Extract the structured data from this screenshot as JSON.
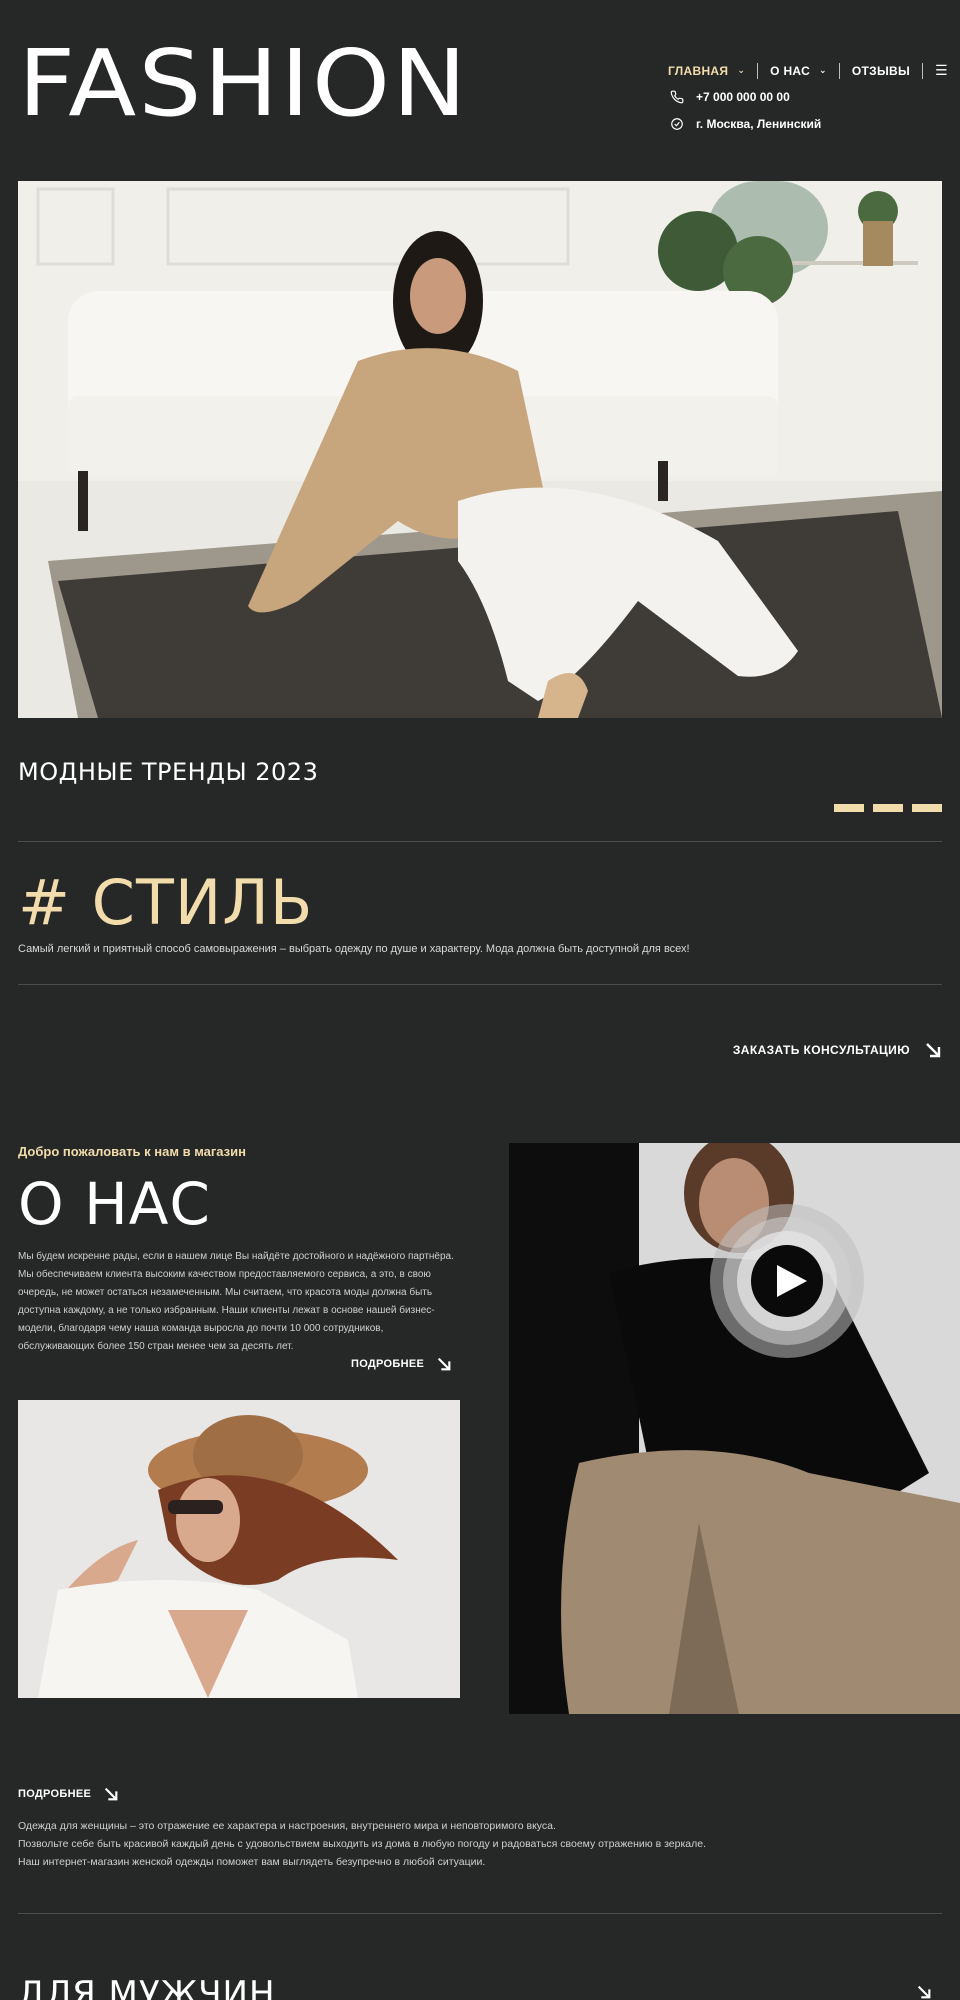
{
  "header": {
    "logo": "FASHION",
    "nav": [
      {
        "label": "ГЛАВНАЯ",
        "active": true,
        "has_dropdown": true
      },
      {
        "label": "О НАС",
        "active": false,
        "has_dropdown": true
      },
      {
        "label": "ОТЗЫВЫ",
        "active": false,
        "has_dropdown": false
      }
    ],
    "menu_icon": "hamburger-icon",
    "phone": "+7 000 000 00 00",
    "address": "г. Москва, Ленинский"
  },
  "hero": {
    "image": "woman-in-beige-sweater-sitting-on-rug-photo"
  },
  "trends": {
    "title": "МОДНЫЕ ТРЕНДЫ 2023",
    "slider_count": 3
  },
  "style": {
    "title": "# СТИЛЬ",
    "description": "Самый легкий и приятный способ самовыражения – выбрать одежду по душе и характеру. Мода должна быть доступной для всех!"
  },
  "consultation": {
    "label": "ЗАКАЗАТЬ КОНСУЛЬТАЦИЮ"
  },
  "about": {
    "welcome": "Добро пожаловать к нам в магазин",
    "title": "О НАС",
    "text": "Мы будем искренне рады, если в нашем лице Вы найдёте достойного и надёжного партнёра. Мы обеспечиваем клиента высоким качеством предоставляемого сервиса, а это, в свою очередь, не может остаться незамеченным. Мы считаем, что красота моды должна быть доступна каждому, а не только избранным. Наши клиенты лежат в основе нашей бизнес-модели, благодаря чему наша команда выросла до почти 10 000 сотрудников, обслуживающих более 150 стран менее чем за десять лет.",
    "more_label": "ПОДРОБНЕЕ"
  },
  "women": {
    "more_label": "ПОДРОБНЕЕ",
    "lines": [
      "Одежда для женщины – это отражение ее характера и настроения, внутреннего мира и неповторимого вкуса.",
      "Позвольте себе быть красивой каждый день с удовольствием выходить из дома в любую погоду и радоваться своему отражению в зеркале.",
      "Наш интернет-магазин женской одежды поможет вам выглядеть безупречно в любой ситуации."
    ]
  },
  "men": {
    "title": "ДЛЯ МУЖЧИН"
  },
  "colors": {
    "background": "#262828",
    "accent": "#f2dcab",
    "divider": "#4a4d4d"
  }
}
